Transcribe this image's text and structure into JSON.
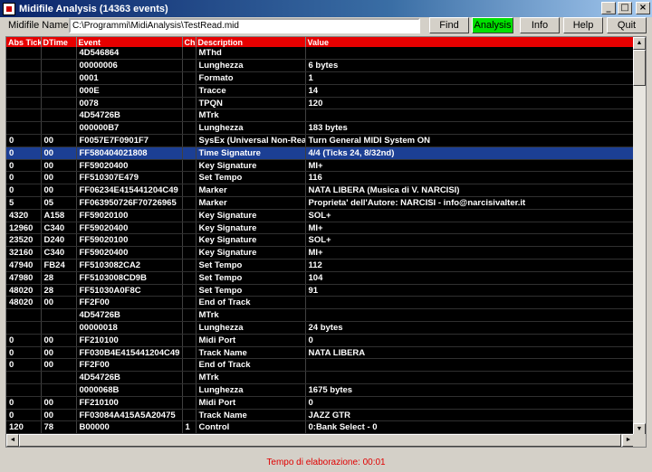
{
  "window": {
    "title": "Midifile Analysis (14363 events)",
    "min_glyph": "_",
    "max_glyph": "□",
    "close_glyph": "×"
  },
  "toolbar": {
    "filename_label": "Midifile Name:",
    "filename_value": "C:\\Programmi\\MidiAnalysis\\TestRead.mid",
    "find_label": "Find",
    "analysis_label": "Analysis",
    "info_label": "Info",
    "help_label": "Help",
    "quit_label": "Quit"
  },
  "table": {
    "columns": [
      "Abs Tick",
      "DTime",
      "Event",
      "Ch",
      "Description",
      "Value"
    ],
    "rows": [
      [
        "",
        "",
        "4D546864",
        "",
        "MThd",
        ""
      ],
      [
        "",
        "",
        "00000006",
        "",
        "Lunghezza",
        "6 bytes"
      ],
      [
        "",
        "",
        "0001",
        "",
        "Formato",
        "1"
      ],
      [
        "",
        "",
        "000E",
        "",
        "Tracce",
        "14"
      ],
      [
        "",
        "",
        "0078",
        "",
        "TPQN",
        "120"
      ],
      [
        "",
        "",
        "4D54726B",
        "",
        "MTrk",
        ""
      ],
      [
        "",
        "",
        "000000B7",
        "",
        "Lunghezza",
        "183 bytes"
      ],
      [
        "0",
        "00",
        "F0057E7F0901F7",
        "",
        "SysEx (Universal Non-Rea",
        "Turn General MIDI System ON"
      ],
      [
        "0",
        "00",
        "FF580404021808",
        "",
        "Time Signature",
        "4/4  (Ticks 24, 8/32nd)"
      ],
      [
        "0",
        "00",
        "FF59020400",
        "",
        "Key Signature",
        "MI+"
      ],
      [
        "0",
        "00",
        "FF510307E479",
        "",
        "Set Tempo",
        "116"
      ],
      [
        "0",
        "00",
        "FF06234E415441204C49",
        "",
        "Marker",
        "NATA LIBERA  (Musica di V. NARCISI)"
      ],
      [
        "5",
        "05",
        "FF063950726F70726965",
        "",
        "Marker",
        "Proprieta' dell'Autore: NARCISI  -  info@narcisivalter.it"
      ],
      [
        "4320",
        "A158",
        "FF59020100",
        "",
        "Key Signature",
        "SOL+"
      ],
      [
        "12960",
        "C340",
        "FF59020400",
        "",
        "Key Signature",
        "MI+"
      ],
      [
        "23520",
        "D240",
        "FF59020100",
        "",
        "Key Signature",
        "SOL+"
      ],
      [
        "32160",
        "C340",
        "FF59020400",
        "",
        "Key Signature",
        "MI+"
      ],
      [
        "47940",
        "FB24",
        "FF5103082CA2",
        "",
        "Set Tempo",
        "112"
      ],
      [
        "47980",
        "28",
        "FF5103008CD9B",
        "",
        "Set Tempo",
        "104"
      ],
      [
        "48020",
        "28",
        "FF51030A0F8C",
        "",
        "Set Tempo",
        "91"
      ],
      [
        "48020",
        "00",
        "FF2F00",
        "",
        "End of Track",
        ""
      ],
      [
        "",
        "",
        "4D54726B",
        "",
        "MTrk",
        ""
      ],
      [
        "",
        "",
        "00000018",
        "",
        "Lunghezza",
        "24 bytes"
      ],
      [
        "0",
        "00",
        "FF210100",
        "",
        "Midi Port",
        "0"
      ],
      [
        "0",
        "00",
        "FF030B4E415441204C49",
        "",
        "Track Name",
        "NATA LIBERA"
      ],
      [
        "0",
        "00",
        "FF2F00",
        "",
        "End of Track",
        ""
      ],
      [
        "",
        "",
        "4D54726B",
        "",
        "MTrk",
        ""
      ],
      [
        "",
        "",
        "0000068B",
        "",
        "Lunghezza",
        "1675 bytes"
      ],
      [
        "0",
        "00",
        "FF210100",
        "",
        "Midi Port",
        "0"
      ],
      [
        "0",
        "00",
        "FF03084A415A5A20475",
        "",
        "Track Name",
        "JAZZ GTR"
      ],
      [
        "120",
        "78",
        "B00000",
        "1",
        "Control",
        "0:Bank Select - 0"
      ]
    ],
    "selected_row": 8
  },
  "scroll": {
    "up": "▲",
    "down": "▼",
    "left": "◄",
    "right": "►"
  },
  "status": {
    "text": "Tempo di elaborazione: 00:01"
  },
  "colors": {
    "header_bg": "#e60000",
    "grid_bg": "#000000",
    "selected_bg": "#1c3f94",
    "analysis_btn": "#00e000",
    "status_text": "#e00000"
  }
}
